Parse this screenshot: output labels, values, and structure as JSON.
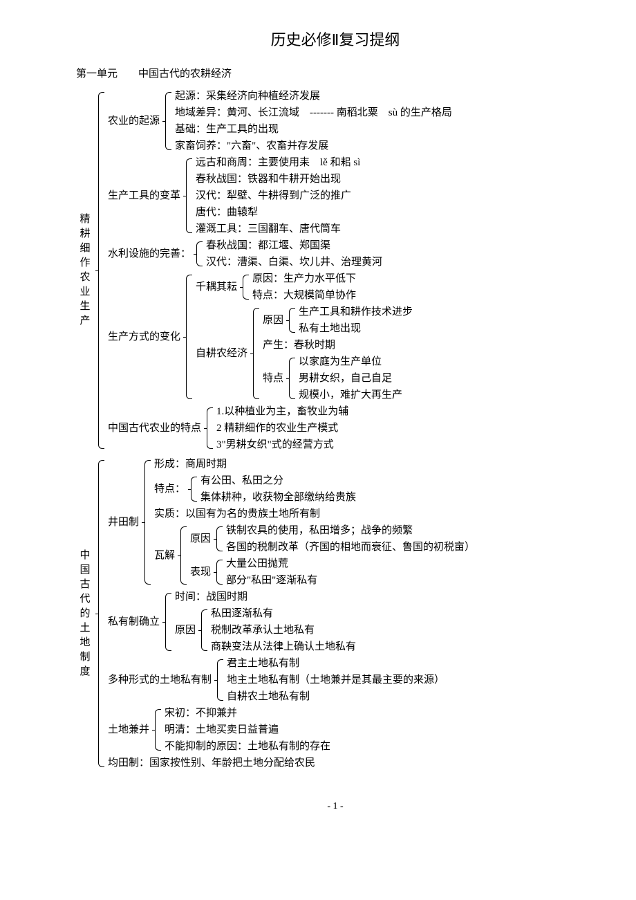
{
  "title": "历史必修Ⅱ复习提纲",
  "unit_heading": "第一单元　　中国古代的农耕经济",
  "s1": {
    "vlabel": [
      "精",
      "耕",
      "细",
      "作",
      "农",
      "业",
      "生",
      "产"
    ],
    "a": {
      "label": "农业的起源",
      "lines": [
        "起源：采集经济向种植经济发展",
        "地域差异：黄河、长江流域　------- 南稻北粟　sù 的生产格局",
        "基础：生产工具的出现",
        "家畜饲养：\"六畜\"、农畜并存发展"
      ]
    },
    "b": {
      "label": "生产工具的变革",
      "lines": [
        "远古和商周：主要使用耒　lě 和耜 sì",
        "春秋战国：铁器和牛耕开始出现",
        "汉代：犁壁、牛耕得到广泛的推广",
        "唐代：曲辕犁",
        "灌溉工具：三国翻车、唐代筒车"
      ]
    },
    "c": {
      "label": "水利设施的完善：",
      "lines": [
        "春秋战国：都江堰、郑国渠",
        "汉代：漕渠、白渠、坎儿井、治理黄河"
      ]
    },
    "d": {
      "label": "生产方式的变化",
      "qian": {
        "label": "千耦其耘",
        "lines": [
          "原因：生产力水平低下",
          "特点：大规模简单协作"
        ]
      },
      "zi": {
        "label": "自耕农经济",
        "reason": {
          "label": "原因",
          "lines": [
            "生产工具和耕作技术进步",
            "私有土地出现"
          ]
        },
        "emerge": "产生：春秋时期",
        "feature": {
          "label": "特点",
          "lines": [
            "以家庭为生产单位",
            "男耕女织，自己自足",
            "规模小，难扩大再生产"
          ]
        }
      }
    },
    "e": {
      "label": "中国古代农业的特点",
      "lines": [
        "1.以种植业为主，畜牧业为辅",
        "2 精耕细作的农业生产模式",
        "3\"男耕女织\"式的经营方式"
      ]
    }
  },
  "s2": {
    "vlabel": [
      "中",
      "国",
      "古",
      "代",
      "的",
      "土",
      "地",
      "制",
      "度"
    ],
    "jing": {
      "label": "井田制",
      "form": "形成：商周时期",
      "feature": {
        "label": "特点：",
        "lines": [
          "有公田、私田之分",
          "集体耕种，收获物全部缴纳给贵族"
        ]
      },
      "essence": "实质：以国有为名的贵族土地所有制",
      "collapse": {
        "label": "瓦解",
        "reason": {
          "label": "原因",
          "lines": [
            "铁制农具的使用，私田增多；战争的频繁",
            "各国的税制改革（齐国的相地而衰征、鲁国的初税亩）"
          ]
        },
        "manifest": {
          "label": "表现",
          "lines": [
            "大量公田抛荒",
            "部分\"私田\"逐渐私有"
          ]
        }
      }
    },
    "priv": {
      "label": "私有制确立",
      "time": "时间：战国时期",
      "reason": {
        "label": "原因",
        "lines": [
          "私田逐渐私有",
          "税制改革承认土地私有",
          "商鞅变法从法律上确认土地私有"
        ]
      }
    },
    "forms": {
      "label": "多种形式的土地私有制",
      "lines": [
        "君主土地私有制",
        "地主土地私有制（土地兼并是其最主要的来源）",
        "自耕农土地私有制"
      ]
    },
    "merge": {
      "label": "土地兼并",
      "lines": [
        "宋初：不抑兼并",
        "明清：土地买卖日益普遍",
        "不能抑制的原因：土地私有制的存在"
      ]
    },
    "jun": "均田制：国家按性别、年龄把土地分配给农民"
  },
  "page": "- 1 -"
}
